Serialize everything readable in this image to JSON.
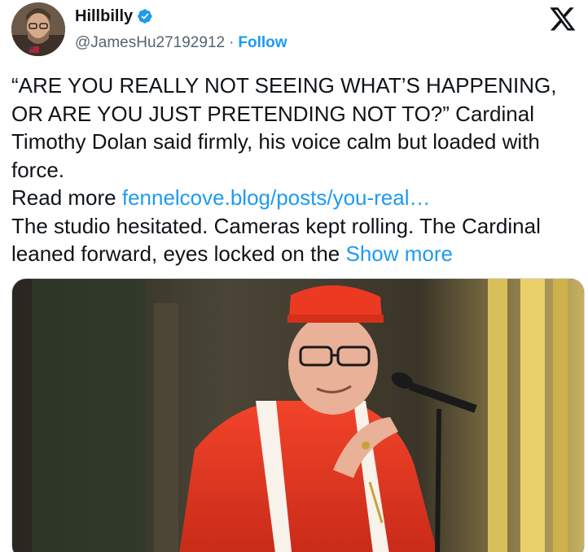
{
  "author": {
    "display_name": "Hillbilly",
    "handle": "@JamesHu27192912",
    "separator": "·",
    "follow_label": "Follow",
    "verified": true
  },
  "platform_icon": "x-logo-icon",
  "tweet": {
    "quote": "“ARE YOU REALLY NOT SEEING WHAT’S HAPPENING, OR ARE YOU JUST PRETENDING NOT TO?”",
    "after_quote": " Cardinal Timothy Dolan said firmly, his voice calm but loaded with force.",
    "read_more_label": "Read more ",
    "read_more_link": "fennelcove.blog/posts/you-real…",
    "body": "The studio hesitated. Cameras kept rolling. The Cardinal leaned forward, eyes locked on the ",
    "show_more_label": "Show more"
  },
  "media": {
    "type": "photo",
    "subject": "cardinal-speaking-at-microphone"
  },
  "colors": {
    "link": "#1d9bf0",
    "text": "#0f1419",
    "secondary": "#536471",
    "verified": "#1d9bf0",
    "vestment_red": "#e8351f"
  }
}
